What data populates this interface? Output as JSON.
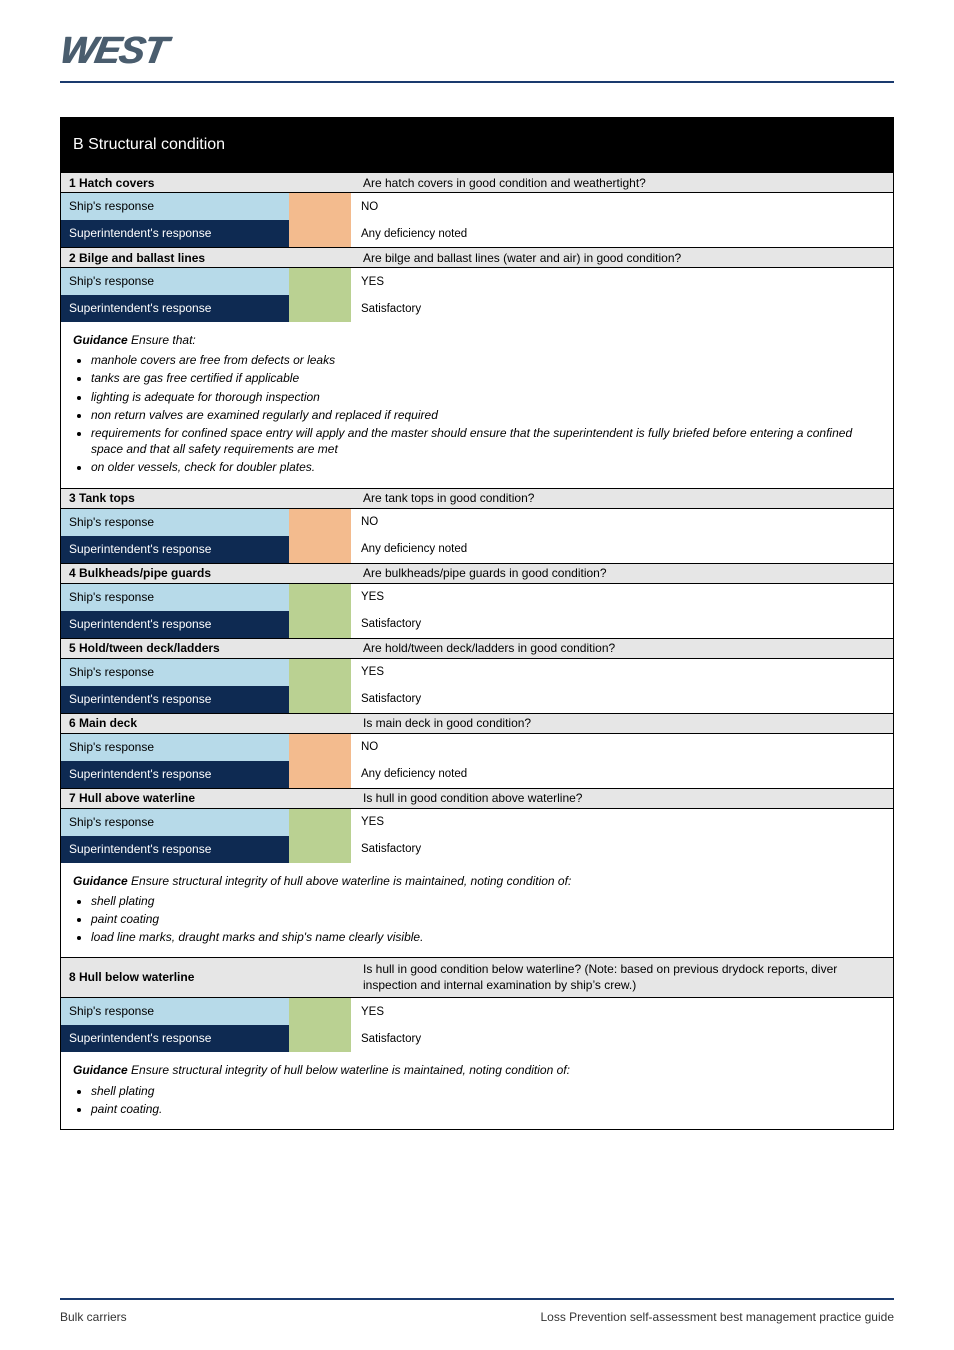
{
  "logo_text": "WEST",
  "header": "B  Structural condition",
  "sections": [
    {
      "q_left": "1  Hatch covers",
      "q_right": "Are hatch covers in good condition and weathertight?",
      "rows": {
        "ship_label": "Ship's response",
        "ship_color": "peach",
        "ship_text": "NO",
        "sup_label": "Superintendent's response",
        "sup_color": "peach",
        "sup_text": "Any deficiency noted"
      }
    },
    {
      "q_left": "2  Bilge and ballast lines",
      "q_right": "Are bilge and ballast lines (water and air) in good condition?",
      "rows": {
        "ship_label": "Ship's response",
        "ship_color": "olive",
        "ship_text": "YES",
        "sup_label": "Superintendent's response",
        "sup_color": "olive",
        "sup_text": "Satisfactory"
      },
      "guidance": {
        "label": "Guidance",
        "intro": "Ensure that:",
        "items": [
          "manhole covers are free from defects or leaks",
          "tanks are gas free certified if applicable",
          "lighting is adequate for thorough inspection",
          "non return valves are examined regularly and replaced if required",
          "requirements for confined space entry will apply and the master should ensure that the superintendent is fully briefed before entering a confined space and that all safety requirements are met",
          "on older vessels, check for doubler plates."
        ]
      }
    },
    {
      "q_left": "3  Tank tops",
      "q_right": "Are tank tops in good condition?",
      "rows": {
        "ship_label": "Ship's response",
        "ship_color": "peach",
        "ship_text": "NO",
        "sup_label": "Superintendent's response",
        "sup_color": "peach",
        "sup_text": "Any deficiency noted"
      }
    },
    {
      "q_left": "4  Bulkheads/pipe guards",
      "q_right": "Are bulkheads/pipe guards in good condition?",
      "rows": {
        "ship_label": "Ship's response",
        "ship_color": "olive",
        "ship_text": "YES",
        "sup_label": "Superintendent's response",
        "sup_color": "olive",
        "sup_text": "Satisfactory"
      }
    },
    {
      "q_left": "5  Hold/tween deck/ladders",
      "q_right": "Are hold/tween deck/ladders in good condition?",
      "rows": {
        "ship_label": "Ship's response",
        "ship_color": "olive",
        "ship_text": "YES",
        "sup_label": "Superintendent's response",
        "sup_color": "olive",
        "sup_text": "Satisfactory"
      }
    },
    {
      "q_left": "6  Main deck",
      "q_right": "Is main deck in good condition?",
      "rows": {
        "ship_label": "Ship's response",
        "ship_color": "peach",
        "ship_text": "NO",
        "sup_label": "Superintendent's response",
        "sup_color": "peach",
        "sup_text": "Any deficiency noted"
      }
    },
    {
      "q_left": "7  Hull above waterline",
      "q_right": "Is hull in good condition above waterline?",
      "rows": {
        "ship_label": "Ship's response",
        "ship_color": "olive",
        "ship_text": "YES",
        "sup_label": "Superintendent's response",
        "sup_color": "olive",
        "sup_text": "Satisfactory"
      },
      "guidance": {
        "label": "Guidance",
        "intro": "Ensure structural integrity of hull above waterline is maintained, noting condition of:",
        "items": [
          "shell plating",
          "paint coating",
          "load line marks, draught marks and ship's name clearly visible."
        ]
      }
    },
    {
      "q_left": "8  Hull below waterline",
      "q_right": "Is hull in good condition below waterline? (Note: based on previous drydock reports, diver inspection and internal examination by ship’s crew.)",
      "rows": {
        "ship_label": "Ship's response",
        "ship_color": "olive",
        "ship_text": "YES",
        "sup_label": "Superintendent's response",
        "sup_color": "olive",
        "sup_text": "Satisfactory"
      },
      "guidance": {
        "label": "Guidance",
        "intro": "Ensure structural integrity of hull below waterline is maintained, noting condition of:",
        "items": [
          "shell plating",
          "paint coating."
        ]
      }
    }
  ],
  "footer_left": "Bulk carriers",
  "footer_right": "Loss Prevention self-assessment best management practice guide"
}
